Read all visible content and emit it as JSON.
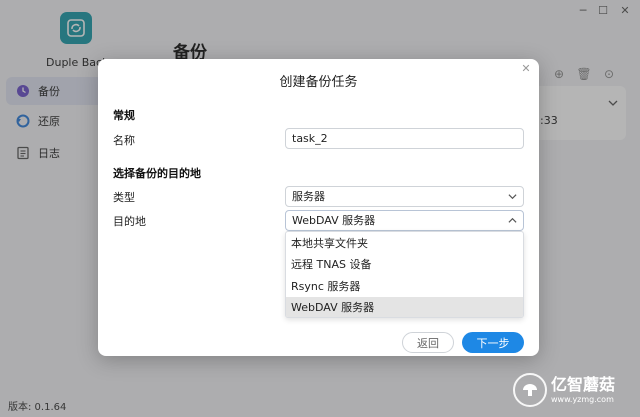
{
  "app": {
    "name": "Duple Backup",
    "version": "版本: 0.1.64",
    "page_title": "备份"
  },
  "sidebar": {
    "items": [
      {
        "label": "备份",
        "icon": "clock-icon",
        "active": true
      },
      {
        "label": "还原",
        "icon": "restore-icon",
        "active": false
      },
      {
        "label": "日志",
        "icon": "log-icon",
        "active": false
      }
    ]
  },
  "task_card": {
    "time_fragment": ":33"
  },
  "modal": {
    "title": "创建备份任务",
    "section_general": "常规",
    "name_label": "名称",
    "name_value": "task_2",
    "section_destination": "选择备份的目的地",
    "type_label": "类型",
    "type_value": "服务器",
    "destination_label": "目的地",
    "destination_value": "WebDAV 服务器",
    "destination_options": [
      {
        "label": "本地共享文件夹",
        "selected": false
      },
      {
        "label": "远程 TNAS 设备",
        "selected": false
      },
      {
        "label": "Rsync 服务器",
        "selected": false
      },
      {
        "label": "WebDAV 服务器",
        "selected": true
      }
    ],
    "back_label": "返回",
    "next_label": "下一步"
  },
  "watermark": {
    "brand": "亿智蘑菇",
    "url": "www.yzmg.com"
  },
  "colors": {
    "accent": "#1e88e5",
    "logo": "#1b9aa8",
    "sidebar_active": "#dfe3f0"
  }
}
